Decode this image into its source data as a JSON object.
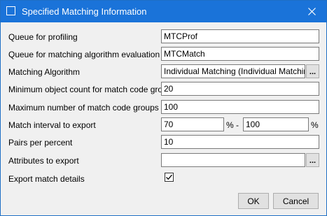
{
  "window": {
    "title": "Specified Matching Information"
  },
  "form": {
    "rows": [
      {
        "label": "Queue for profiling",
        "value": "MTCProf"
      },
      {
        "label": "Queue for matching algorithm evaluation",
        "value": "MTCMatch"
      },
      {
        "label": "Matching Algorithm",
        "value": "Individual Matching (Individual Matching)",
        "browse_label": "..."
      },
      {
        "label": "Minimum object count for match code groups",
        "value": "20"
      },
      {
        "label": "Maximum number of match code groups",
        "value": "100"
      },
      {
        "label": "Match interval to export",
        "from": "70",
        "from_unit": "%",
        "separator": "-",
        "to": "100",
        "to_unit": "%"
      },
      {
        "label": "Pairs per percent",
        "value": "10"
      },
      {
        "label": "Attributes to export",
        "value": "",
        "browse_label": "..."
      },
      {
        "label": "Export match details",
        "checked": true
      }
    ]
  },
  "buttons": {
    "ok": "OK",
    "cancel": "Cancel"
  },
  "icons": {
    "app": "window-icon",
    "close": "close-icon",
    "check": "checkmark-icon"
  },
  "colors": {
    "titlebar": "#1a73d9",
    "dialog_background": "#f0f0f0"
  }
}
